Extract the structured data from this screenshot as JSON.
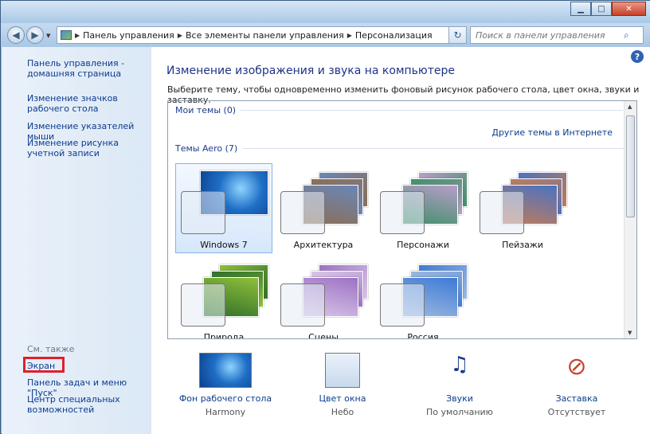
{
  "address": {
    "crumbs": [
      "Панель управления",
      "Все элементы панели управления",
      "Персонализация"
    ],
    "search_placeholder": "Поиск в панели управления"
  },
  "sidebar": {
    "links": [
      "Панель управления - домашняя страница",
      "Изменение значков рабочего стола",
      "Изменение указателей мыши",
      "Изменение рисунка учетной записи"
    ],
    "see_also_title": "См. также",
    "see_also": [
      "Экран",
      "Панель задач и меню \"Пуск\"",
      "Центр специальных возможностей"
    ]
  },
  "main": {
    "title": "Изменение изображения и звука на компьютере",
    "subtitle": "Выберите тему, чтобы одновременно изменить фоновый рисунок рабочего стола, цвет окна, звуки и заставку.",
    "my_themes": "Мои темы (0)",
    "more_themes_link": "Другие темы в Интернете",
    "aero_themes": "Темы Aero (7)",
    "themes": [
      {
        "label": "Windows 7",
        "selected": true,
        "colors": [
          "#1f6fc5",
          "#0a3f8f"
        ]
      },
      {
        "label": "Архитектура",
        "selected": false,
        "colors": [
          "#6a87b8",
          "#8c6e55"
        ]
      },
      {
        "label": "Персонажи",
        "selected": false,
        "colors": [
          "#b89ec9",
          "#3f8f6a"
        ]
      },
      {
        "label": "Пейзажи",
        "selected": false,
        "colors": [
          "#4a73c2",
          "#c17b5b"
        ]
      },
      {
        "label": "Природа",
        "selected": false,
        "colors": [
          "#8fbf3a",
          "#2f6f2a"
        ]
      },
      {
        "label": "Сцены",
        "selected": false,
        "colors": [
          "#9c72c4",
          "#d9c6e8"
        ]
      },
      {
        "label": "Россия",
        "selected": false,
        "colors": [
          "#3d7bd6",
          "#9db8e0"
        ]
      }
    ]
  },
  "bottom": [
    {
      "label": "Фон рабочего стола",
      "value": "Harmony",
      "icon": "desktop-background-icon"
    },
    {
      "label": "Цвет окна",
      "value": "Небо",
      "icon": "window-color-icon"
    },
    {
      "label": "Звуки",
      "value": "По умолчанию",
      "icon": "sounds-icon"
    },
    {
      "label": "Заставка",
      "value": "Отсутствует",
      "icon": "screensaver-icon"
    }
  ],
  "colors": {
    "link": "#0b3c8d",
    "highlight_box": "#e0202a",
    "title": "#1e3388"
  }
}
